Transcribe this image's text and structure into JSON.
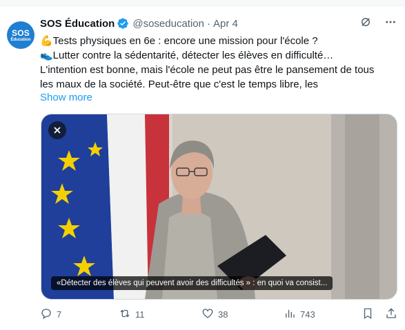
{
  "author": {
    "name": "SOS Éducation",
    "handle": "@soseducation",
    "separator": "·",
    "date": "Apr 4",
    "avatar_line1": "SOS",
    "avatar_line2": "Éducation"
  },
  "tweet": {
    "lines": [
      "💪Tests physiques en 6e : encore une mission pour l'école ?",
      "👟Lutter contre la sédentarité, détecter les élèves en difficulté…",
      "L'intention est bonne, mais l'école ne peut pas être le pansement de tous",
      "les maux de la société.  Peut-être que c'est le temps libre, les"
    ],
    "show_more": "Show more"
  },
  "media": {
    "caption": "«Détecter des élèves qui peuvent avoir des difficultés » : en quoi va consist..."
  },
  "stats": {
    "replies": "7",
    "retweets": "11",
    "likes": "38",
    "views": "743"
  },
  "icons": {
    "verified": "verified-badge-icon",
    "grok": "grok-icon",
    "more": "more-icon",
    "close": "close-icon",
    "reply": "reply-icon",
    "retweet": "retweet-icon",
    "like": "heart-icon",
    "views": "views-icon",
    "bookmark": "bookmark-icon",
    "share": "share-icon"
  },
  "colors": {
    "accent": "#1d9bf0",
    "text_secondary": "#536471",
    "avatar_bg": "#1f7fd1"
  }
}
